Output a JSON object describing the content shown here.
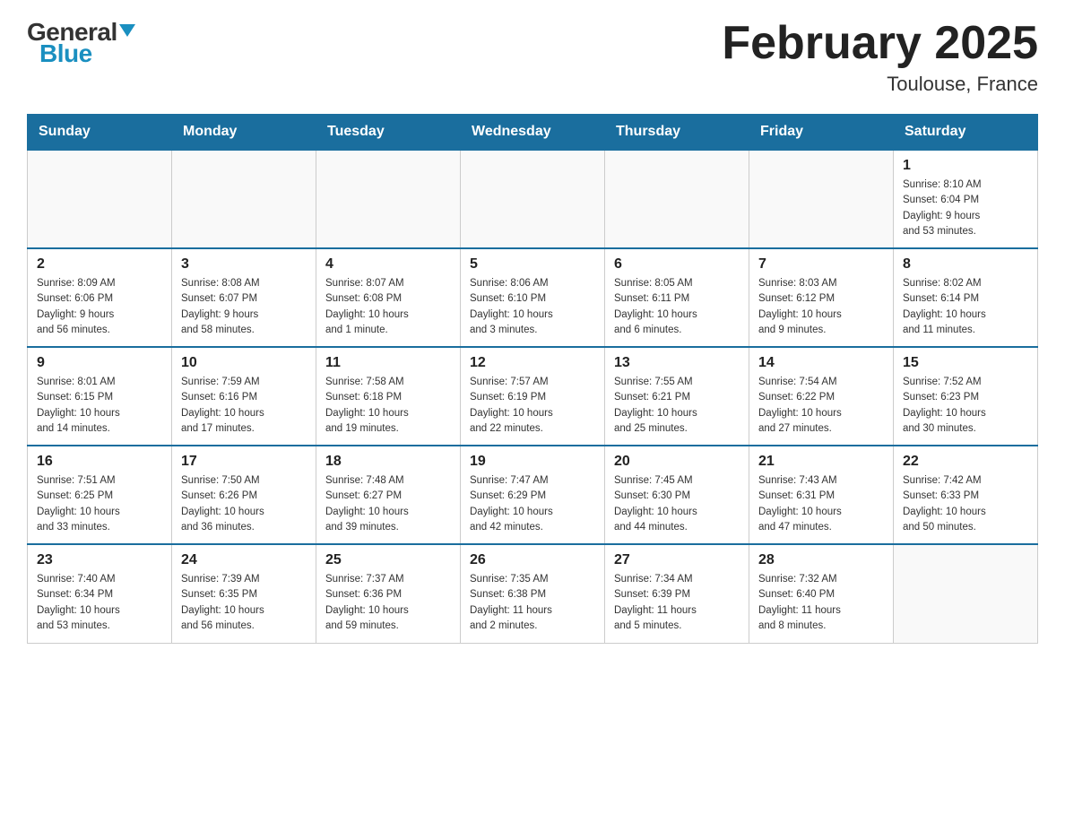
{
  "header": {
    "logo_general": "General",
    "logo_blue": "Blue",
    "title": "February 2025",
    "subtitle": "Toulouse, France"
  },
  "days_of_week": [
    "Sunday",
    "Monday",
    "Tuesday",
    "Wednesday",
    "Thursday",
    "Friday",
    "Saturday"
  ],
  "weeks": [
    {
      "days": [
        {
          "number": "",
          "info": ""
        },
        {
          "number": "",
          "info": ""
        },
        {
          "number": "",
          "info": ""
        },
        {
          "number": "",
          "info": ""
        },
        {
          "number": "",
          "info": ""
        },
        {
          "number": "",
          "info": ""
        },
        {
          "number": "1",
          "info": "Sunrise: 8:10 AM\nSunset: 6:04 PM\nDaylight: 9 hours\nand 53 minutes."
        }
      ]
    },
    {
      "days": [
        {
          "number": "2",
          "info": "Sunrise: 8:09 AM\nSunset: 6:06 PM\nDaylight: 9 hours\nand 56 minutes."
        },
        {
          "number": "3",
          "info": "Sunrise: 8:08 AM\nSunset: 6:07 PM\nDaylight: 9 hours\nand 58 minutes."
        },
        {
          "number": "4",
          "info": "Sunrise: 8:07 AM\nSunset: 6:08 PM\nDaylight: 10 hours\nand 1 minute."
        },
        {
          "number": "5",
          "info": "Sunrise: 8:06 AM\nSunset: 6:10 PM\nDaylight: 10 hours\nand 3 minutes."
        },
        {
          "number": "6",
          "info": "Sunrise: 8:05 AM\nSunset: 6:11 PM\nDaylight: 10 hours\nand 6 minutes."
        },
        {
          "number": "7",
          "info": "Sunrise: 8:03 AM\nSunset: 6:12 PM\nDaylight: 10 hours\nand 9 minutes."
        },
        {
          "number": "8",
          "info": "Sunrise: 8:02 AM\nSunset: 6:14 PM\nDaylight: 10 hours\nand 11 minutes."
        }
      ]
    },
    {
      "days": [
        {
          "number": "9",
          "info": "Sunrise: 8:01 AM\nSunset: 6:15 PM\nDaylight: 10 hours\nand 14 minutes."
        },
        {
          "number": "10",
          "info": "Sunrise: 7:59 AM\nSunset: 6:16 PM\nDaylight: 10 hours\nand 17 minutes."
        },
        {
          "number": "11",
          "info": "Sunrise: 7:58 AM\nSunset: 6:18 PM\nDaylight: 10 hours\nand 19 minutes."
        },
        {
          "number": "12",
          "info": "Sunrise: 7:57 AM\nSunset: 6:19 PM\nDaylight: 10 hours\nand 22 minutes."
        },
        {
          "number": "13",
          "info": "Sunrise: 7:55 AM\nSunset: 6:21 PM\nDaylight: 10 hours\nand 25 minutes."
        },
        {
          "number": "14",
          "info": "Sunrise: 7:54 AM\nSunset: 6:22 PM\nDaylight: 10 hours\nand 27 minutes."
        },
        {
          "number": "15",
          "info": "Sunrise: 7:52 AM\nSunset: 6:23 PM\nDaylight: 10 hours\nand 30 minutes."
        }
      ]
    },
    {
      "days": [
        {
          "number": "16",
          "info": "Sunrise: 7:51 AM\nSunset: 6:25 PM\nDaylight: 10 hours\nand 33 minutes."
        },
        {
          "number": "17",
          "info": "Sunrise: 7:50 AM\nSunset: 6:26 PM\nDaylight: 10 hours\nand 36 minutes."
        },
        {
          "number": "18",
          "info": "Sunrise: 7:48 AM\nSunset: 6:27 PM\nDaylight: 10 hours\nand 39 minutes."
        },
        {
          "number": "19",
          "info": "Sunrise: 7:47 AM\nSunset: 6:29 PM\nDaylight: 10 hours\nand 42 minutes."
        },
        {
          "number": "20",
          "info": "Sunrise: 7:45 AM\nSunset: 6:30 PM\nDaylight: 10 hours\nand 44 minutes."
        },
        {
          "number": "21",
          "info": "Sunrise: 7:43 AM\nSunset: 6:31 PM\nDaylight: 10 hours\nand 47 minutes."
        },
        {
          "number": "22",
          "info": "Sunrise: 7:42 AM\nSunset: 6:33 PM\nDaylight: 10 hours\nand 50 minutes."
        }
      ]
    },
    {
      "days": [
        {
          "number": "23",
          "info": "Sunrise: 7:40 AM\nSunset: 6:34 PM\nDaylight: 10 hours\nand 53 minutes."
        },
        {
          "number": "24",
          "info": "Sunrise: 7:39 AM\nSunset: 6:35 PM\nDaylight: 10 hours\nand 56 minutes."
        },
        {
          "number": "25",
          "info": "Sunrise: 7:37 AM\nSunset: 6:36 PM\nDaylight: 10 hours\nand 59 minutes."
        },
        {
          "number": "26",
          "info": "Sunrise: 7:35 AM\nSunset: 6:38 PM\nDaylight: 11 hours\nand 2 minutes."
        },
        {
          "number": "27",
          "info": "Sunrise: 7:34 AM\nSunset: 6:39 PM\nDaylight: 11 hours\nand 5 minutes."
        },
        {
          "number": "28",
          "info": "Sunrise: 7:32 AM\nSunset: 6:40 PM\nDaylight: 11 hours\nand 8 minutes."
        },
        {
          "number": "",
          "info": ""
        }
      ]
    }
  ]
}
